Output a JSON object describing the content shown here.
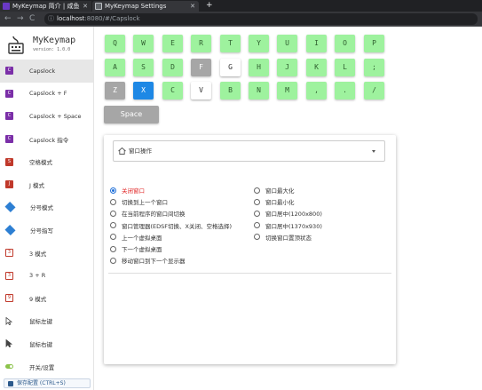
{
  "browser": {
    "tabs": [
      {
        "title": "MyKeymap 简介 | 咸鱼"
      },
      {
        "title": "MyKeymap Settings"
      }
    ],
    "tab_close": "✕",
    "new_tab": "+",
    "nav": {
      "back": "←",
      "forward": "→",
      "reload": "C"
    },
    "url_host": "localhost",
    "url_rest": ":8080/#/Capslock",
    "url_info_icon": "ⓘ"
  },
  "app": {
    "name": "MyKeymap",
    "version": "version: 1.0.0"
  },
  "sidebar": {
    "items": [
      {
        "label": "Capslock",
        "icon": "capslock-icon",
        "glyph": "C"
      },
      {
        "label": "Capslock + F",
        "icon": "capslock-icon",
        "glyph": "C"
      },
      {
        "label": "Capslock + Space",
        "icon": "capslock-icon",
        "glyph": "C"
      },
      {
        "label": "Capslock 指令",
        "icon": "capslock-icon",
        "glyph": "C"
      },
      {
        "label": "空格模式",
        "icon": "space-mode-icon",
        "glyph": "S"
      },
      {
        "label": "J 模式",
        "icon": "j-mode-icon",
        "glyph": "J"
      },
      {
        "label": "分号模式",
        "icon": "diamond-icon",
        "glyph": ""
      },
      {
        "label": "分号指写",
        "icon": "diamond-icon",
        "glyph": ""
      },
      {
        "label": "3 模式",
        "icon": "digit-3-icon",
        "glyph": "3"
      },
      {
        "label": "3 + R",
        "icon": "digit-3-icon",
        "glyph": "3"
      },
      {
        "label": "9 模式",
        "icon": "digit-9-icon",
        "glyph": "9"
      },
      {
        "label": "鼠标左键",
        "icon": "cursor-outline-icon",
        "glyph": ""
      },
      {
        "label": "鼠标右键",
        "icon": "cursor-filled-icon",
        "glyph": ""
      },
      {
        "label": "开关/设置",
        "icon": "toggle-icon",
        "glyph": ""
      }
    ],
    "active_index": 0,
    "save_label": "保存配置 (CTRL+S)"
  },
  "keyboard": {
    "row1": [
      "Q",
      "W",
      "E",
      "R",
      "T",
      "Y",
      "U",
      "I",
      "O",
      "P"
    ],
    "row2": [
      "A",
      "S",
      "D",
      "F",
      "G",
      "H",
      "J",
      "K",
      "L",
      ";"
    ],
    "row3": [
      "Z",
      "X",
      "C",
      "V",
      "B",
      "N",
      "M",
      ",",
      ".",
      "/"
    ],
    "space": "Space",
    "key_states": {
      "F": "disabled",
      "G": "available",
      "Z": "disabled",
      "X": "selected",
      "V": "available"
    },
    "colors": {
      "mapped": "#9ef29e",
      "disabled": "#a6a6a6",
      "selected": "#1e88e5",
      "available": "#ffffff"
    }
  },
  "panel": {
    "category": "窗口操作",
    "options_left": [
      "关闭窗口",
      "切换到上一个窗口",
      "在当前程序的窗口间切换",
      "窗口管理器(EDSF切换、X关闭、空格选择)",
      "上一个虚拟桌面",
      "下一个虚拟桌面",
      "移动窗口到下一个显示器"
    ],
    "options_right": [
      "窗口最大化",
      "窗口最小化",
      "窗口居中(1200x800)",
      "窗口居中(1370x930)",
      "切换窗口置顶状态"
    ],
    "selected": "关闭窗口"
  }
}
